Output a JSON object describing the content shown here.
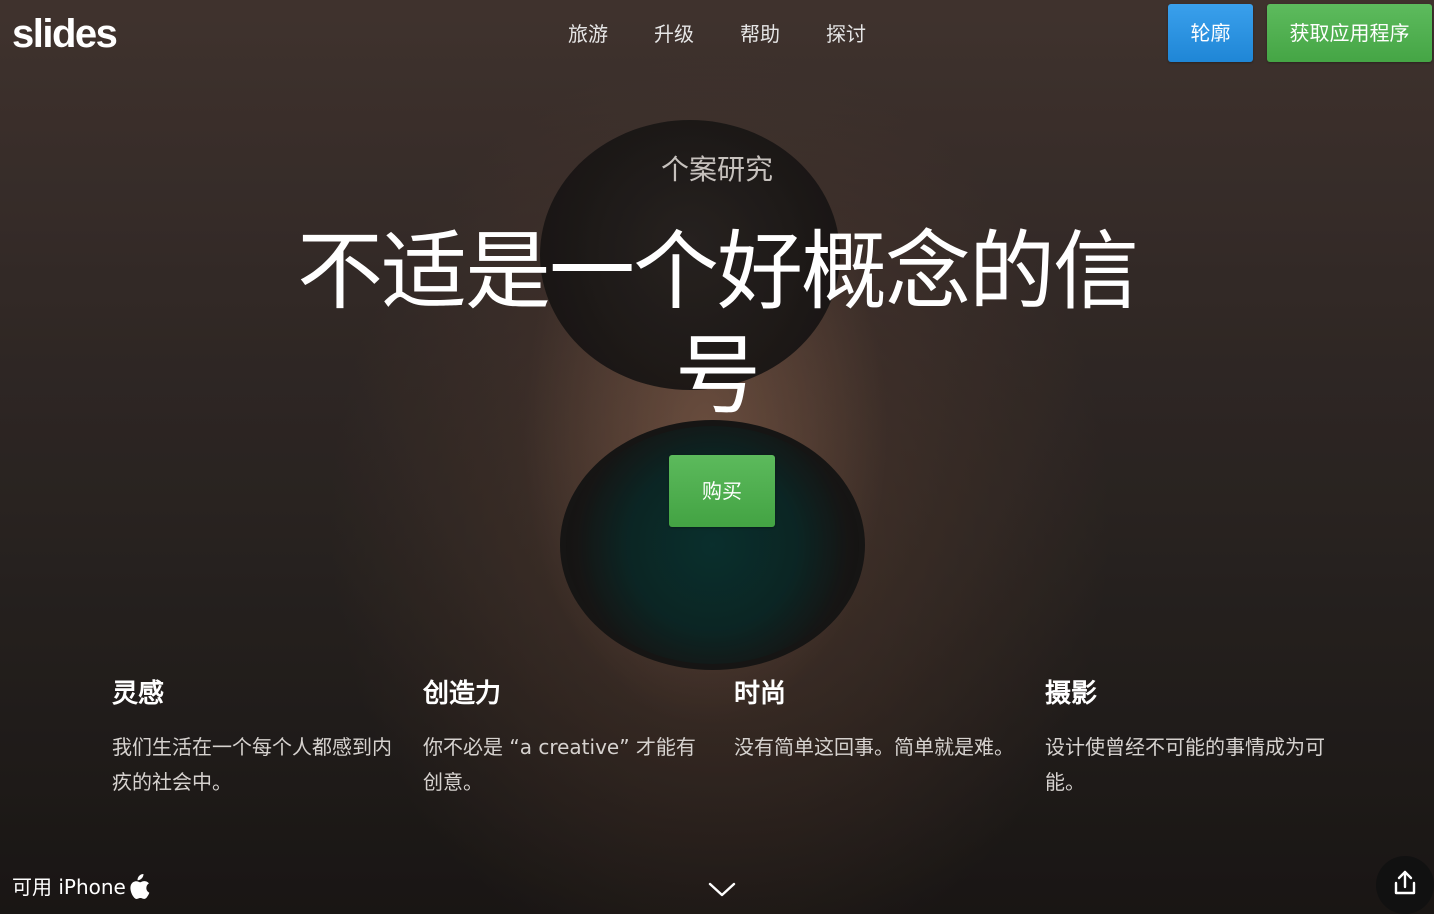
{
  "header": {
    "logo": "slides",
    "nav": [
      "旅游",
      "升级",
      "帮助",
      "探讨"
    ],
    "outline_button": "轮廓",
    "get_app_button": "获取应用程序"
  },
  "hero": {
    "eyebrow": "个案研究",
    "headline": "不适是一个好概念的信号",
    "buy_button": "购买"
  },
  "features": [
    {
      "title": "灵感",
      "text": "我们生活在一个每个人都感到内疚的社会中。"
    },
    {
      "title": "创造力",
      "text": "你不必是 “a creative” 才能有创意。"
    },
    {
      "title": "时尚",
      "text": "没有简单这回事。简单就是难。"
    },
    {
      "title": "摄影",
      "text": "设计使曾经不可能的事情成为可能。"
    }
  ],
  "footer": {
    "available_text": "可用 iPhone",
    "apple_icon": "apple-icon",
    "scroll_icon": "chevron-down-icon",
    "share_icon": "share-icon"
  },
  "colors": {
    "blue_button": "#2a92e0",
    "green_button": "#4caf50",
    "text": "#ffffff"
  }
}
